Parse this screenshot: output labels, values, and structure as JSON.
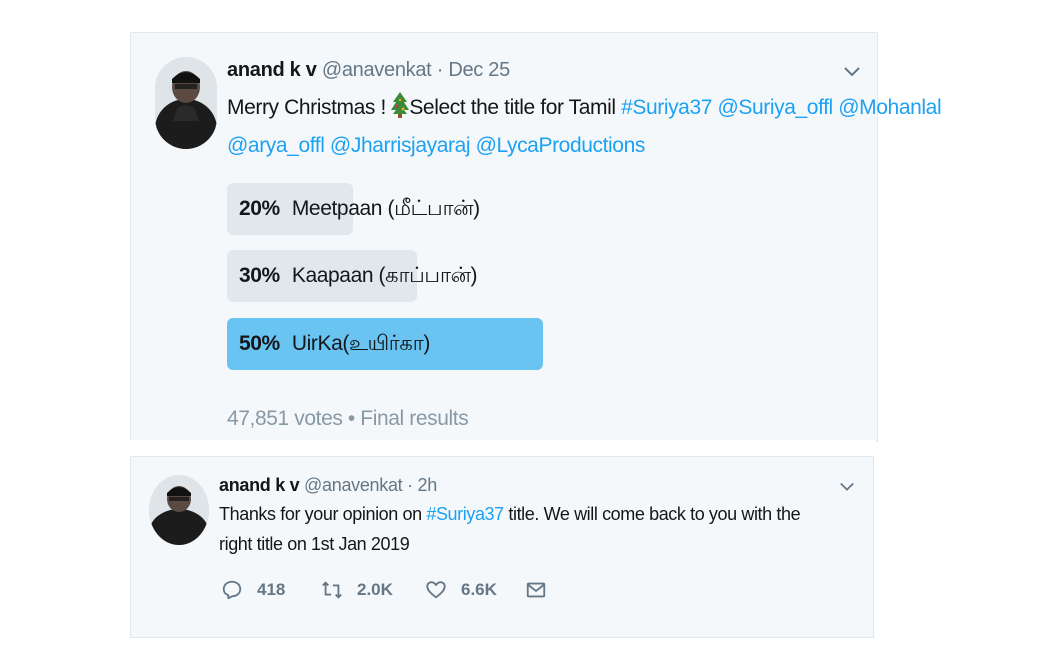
{
  "tweet1": {
    "name": "anand k v",
    "handle": "@anavenkat",
    "time": "Dec 25",
    "text_line1_prefix": "Merry Christmas ! ",
    "text_line1_suffix": "Select the title for Tamil ",
    "hashtag": "#Suriya37",
    "mentions_line1": [
      "@Suriya_offl",
      "@Mohanlal"
    ],
    "mentions_line2": [
      "@arya_offl",
      "@Jharrisjayaraj",
      "@LycaProductions"
    ],
    "poll": {
      "options": [
        {
          "percent": "20%",
          "percent_value": 20,
          "label": "Meetpaan (மீட்பான்)",
          "winner": false
        },
        {
          "percent": "30%",
          "percent_value": 30,
          "label": "Kaapaan (காப்பான்)",
          "winner": false
        },
        {
          "percent": "50%",
          "percent_value": 50,
          "label": "UirKa(உயிர்கா)",
          "winner": true
        }
      ],
      "votes": "47,851 votes",
      "status": "Final results"
    }
  },
  "tweet2": {
    "name": "anand k v",
    "handle": "@anavenkat",
    "time": "2h",
    "text_part1": "Thanks for your opinion on ",
    "hashtag": "#Suriya37",
    "text_part2": " title. We will come back to you with the",
    "text_line2": "right title on 1st Jan 2019",
    "replies": "418",
    "retweets": "2.0K",
    "likes": "6.6K"
  },
  "icons": {
    "reply": "reply-icon",
    "retweet": "retweet-icon",
    "like": "heart-icon",
    "dm": "envelope-icon",
    "caret": "chevron-down-icon",
    "emoji": "christmas-tree-icon"
  },
  "colors": {
    "link": "#1da1f2",
    "poll_winner": "#6ac4f2",
    "poll_other": "#e1e8ed"
  }
}
